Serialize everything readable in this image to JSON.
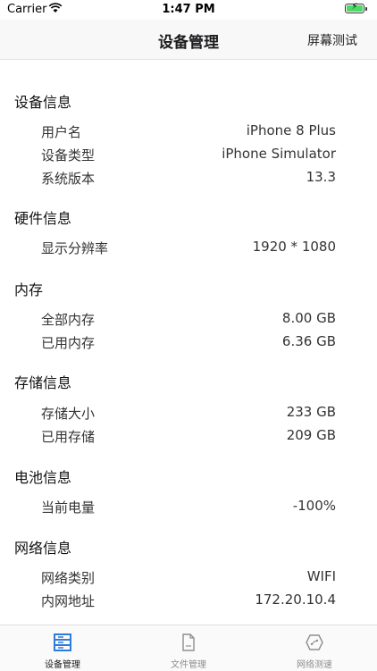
{
  "status_bar": {
    "carrier": "Carrier",
    "time": "1:47 PM"
  },
  "nav": {
    "title": "设备管理",
    "right_button": "屏幕测试"
  },
  "sections": {
    "device": {
      "title": "设备信息",
      "rows": [
        {
          "label": "用户名",
          "value": "iPhone 8 Plus"
        },
        {
          "label": "设备类型",
          "value": "iPhone Simulator"
        },
        {
          "label": "系统版本",
          "value": "13.3"
        }
      ]
    },
    "hardware": {
      "title": "硬件信息",
      "rows": [
        {
          "label": "显示分辨率",
          "value": "1920 * 1080"
        }
      ]
    },
    "memory": {
      "title": "内存",
      "rows": [
        {
          "label": "全部内存",
          "value": "8.00 GB"
        },
        {
          "label": "已用内存",
          "value": "6.36 GB"
        }
      ]
    },
    "storage": {
      "title": "存储信息",
      "rows": [
        {
          "label": "存储大小",
          "value": "233 GB"
        },
        {
          "label": "已用存储",
          "value": "209 GB"
        }
      ]
    },
    "battery": {
      "title": "电池信息",
      "rows": [
        {
          "label": "当前电量",
          "value": "-100%"
        }
      ]
    },
    "network": {
      "title": "网络信息",
      "rows": [
        {
          "label": "网络类别",
          "value": "WIFI"
        },
        {
          "label": "内网地址",
          "value": "172.20.10.4"
        }
      ]
    }
  },
  "tabs": [
    {
      "label": "设备管理",
      "icon": "server-icon",
      "active": true
    },
    {
      "label": "文件管理",
      "icon": "document-icon",
      "active": false
    },
    {
      "label": "网络测速",
      "icon": "network-shield-icon",
      "active": false
    }
  ],
  "colors": {
    "active_tab": "#1c1c1e",
    "inactive_tab": "#8e8e93",
    "accent_icon": "#2f7bdc",
    "battery": "#4cd964"
  }
}
